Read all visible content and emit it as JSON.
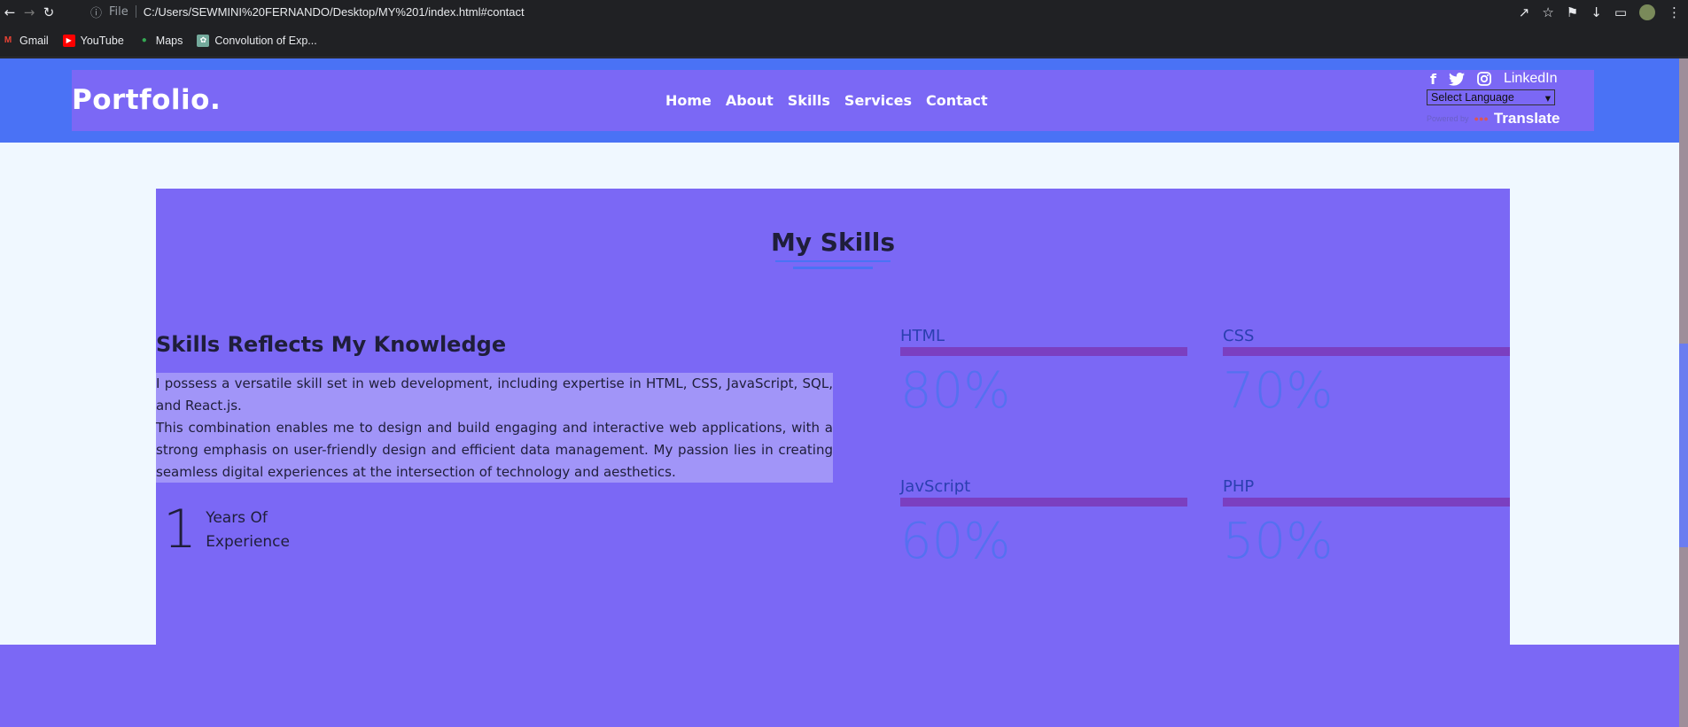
{
  "browser": {
    "url_prefix": "File",
    "url": "C:/Users/SEWMINI%20FERNANDO/Desktop/MY%201/index.html#contact",
    "bookmarks": [
      {
        "label": "Gmail",
        "icon": "gmail-icon"
      },
      {
        "label": "YouTube",
        "icon": "youtube-icon"
      },
      {
        "label": "Maps",
        "icon": "maps-icon"
      },
      {
        "label": "Convolution of Exp...",
        "icon": "chatgpt-icon"
      }
    ]
  },
  "header": {
    "logo": "Portfolio.",
    "nav": [
      "Home",
      "About",
      "Skills",
      "Services",
      "Contact"
    ],
    "social": {
      "linkedin": "LinkedIn"
    },
    "language_select": "Select Language",
    "powered_by": "Powered by",
    "translate": "Translate"
  },
  "skills": {
    "title": "My Skills",
    "subtitle": "Skills Reflects My Knowledge",
    "description_1": "I possess a versatile skill set in web development, including expertise in HTML, CSS, JavaScript, SQL, and React.js.",
    "description_2": "This combination enables me to design and build engaging and interactive web applications, with a strong emphasis on user-friendly design and efficient data management. My passion lies in creating seamless digital experiences at the intersection of technology and aesthetics.",
    "years_number": "1",
    "years_label_1": "Years Of",
    "years_label_2": "Experience",
    "items": [
      {
        "name": "HTML",
        "percent": "80%",
        "level": 0.8
      },
      {
        "name": "CSS",
        "percent": "70%",
        "level": 0.7
      },
      {
        "name": "JavScript",
        "percent": "60%",
        "level": 0.6
      },
      {
        "name": "PHP",
        "percent": "50%",
        "level": 0.5
      }
    ]
  },
  "colors": {
    "header_bg": "#4a72f5",
    "accent": "#7b68f5",
    "page_bg": "#f0f8ff",
    "bar": "#7b3fc0"
  }
}
